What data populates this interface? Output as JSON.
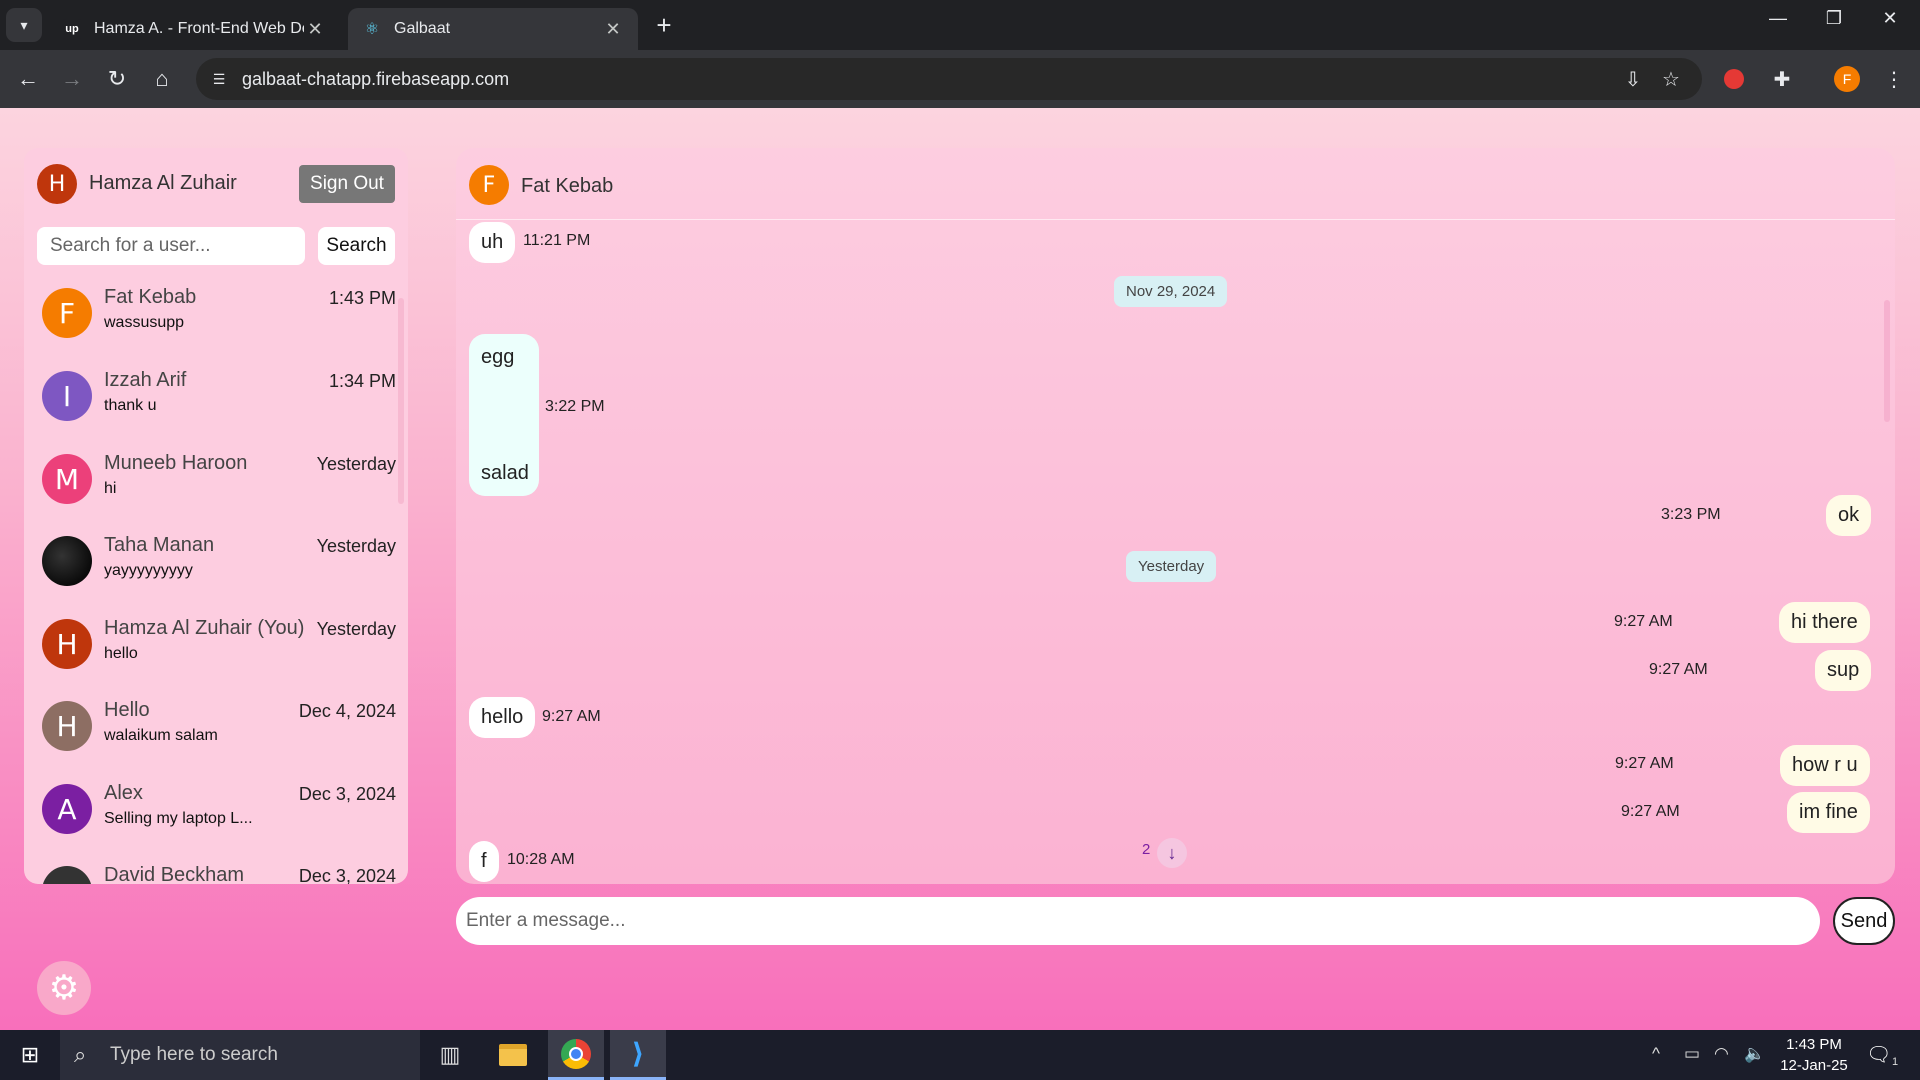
{
  "browser": {
    "tabs": [
      {
        "title": "Hamza A. - Front-End Web Dev",
        "favicon": "upwork-icon"
      },
      {
        "title": "Galbaat",
        "favicon": "react-icon"
      }
    ],
    "url": "galbaat-chatapp.firebaseapp.com",
    "profile_initial": "F"
  },
  "sidebar": {
    "current_user": {
      "initial": "H",
      "name": "Hamza Al Zuhair",
      "color": "#bf360c"
    },
    "signout_label": "Sign Out",
    "search_placeholder": "Search for a user...",
    "search_label": "Search",
    "contacts": [
      {
        "initial": "F",
        "name": "Fat Kebab",
        "last_message": "wassusupp",
        "time": "1:43 PM",
        "color": "#f57c00"
      },
      {
        "initial": "I",
        "name": "Izzah Arif",
        "last_message": "thank u",
        "time": "1:34 PM",
        "color": "#7e57c2"
      },
      {
        "initial": "M",
        "name": "Muneeb Haroon",
        "last_message": "hi",
        "time": "Yesterday",
        "color": "#ec407a"
      },
      {
        "initial": "",
        "name": "Taha Manan",
        "last_message": "yayyyyyyyyy",
        "time": "Yesterday",
        "color": "#111111"
      },
      {
        "initial": "H",
        "name": "Hamza Al Zuhair (You)",
        "last_message": "hello",
        "time": "Yesterday",
        "color": "#bf360c"
      },
      {
        "initial": "H",
        "name": "Hello",
        "last_message": "walaikum salam",
        "time": "Dec 4, 2024",
        "color": "#8d6e63"
      },
      {
        "initial": "A",
        "name": "Alex",
        "last_message": "Selling my laptop L...",
        "time": "Dec 3, 2024",
        "color": "#7b1fa2"
      },
      {
        "initial": "",
        "name": "David Beckham",
        "last_message": "",
        "time": "Dec 3, 2024",
        "color": "#333333"
      }
    ]
  },
  "chat": {
    "contact": {
      "initial": "F",
      "name": "Fat Kebab",
      "color": "#f57c00"
    },
    "messages": {
      "m1": {
        "text": "uh",
        "time": "11:21 PM"
      },
      "date1": "Nov 29, 2024",
      "m2": {
        "line1": "egg",
        "line2": "salad",
        "time": "3:22 PM"
      },
      "m3": {
        "text": "ok",
        "time": "3:23 PM"
      },
      "date2": "Yesterday",
      "m4": {
        "text": "hi there",
        "time": "9:27 AM"
      },
      "m5": {
        "text": "sup",
        "time": "9:27 AM"
      },
      "m6": {
        "text": "hello",
        "time": "9:27 AM"
      },
      "m7": {
        "text": "how r u",
        "time": "9:27 AM"
      },
      "m8": {
        "text": "im fine",
        "time": "9:27 AM"
      },
      "m9": {
        "text": "f",
        "time": "10:28 AM"
      }
    },
    "unread_count": "2",
    "input_placeholder": "Enter a message...",
    "send_label": "Send"
  },
  "taskbar": {
    "search_placeholder": "Type here to search",
    "time": "1:43 PM",
    "date": "12-Jan-25",
    "notification_count": "1"
  }
}
